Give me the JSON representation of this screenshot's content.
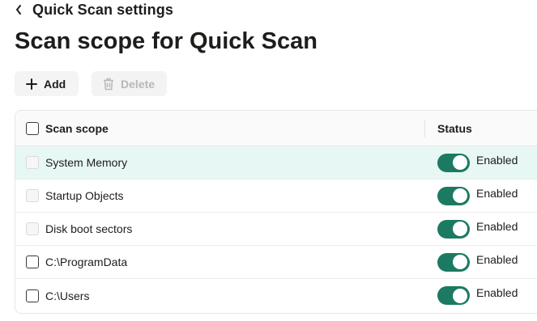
{
  "header": {
    "back_label": "Quick Scan settings",
    "title": "Scan scope for Quick Scan"
  },
  "toolbar": {
    "add_label": "Add",
    "delete_label": "Delete"
  },
  "table": {
    "columns": [
      "Scan scope",
      "Status"
    ],
    "rows": [
      {
        "name": "System Memory",
        "status": "Enabled",
        "checkbox_disabled": true,
        "highlighted": true
      },
      {
        "name": "Startup Objects",
        "status": "Enabled",
        "checkbox_disabled": true,
        "highlighted": false
      },
      {
        "name": "Disk boot sectors",
        "status": "Enabled",
        "checkbox_disabled": true,
        "highlighted": false
      },
      {
        "name": "C:\\ProgramData",
        "status": "Enabled",
        "checkbox_disabled": false,
        "highlighted": false
      },
      {
        "name": "C:\\Users",
        "status": "Enabled",
        "checkbox_disabled": false,
        "highlighted": false
      }
    ]
  },
  "colors": {
    "toggle_on": "#1b7a61",
    "row_highlight": "#e7f7f4"
  }
}
